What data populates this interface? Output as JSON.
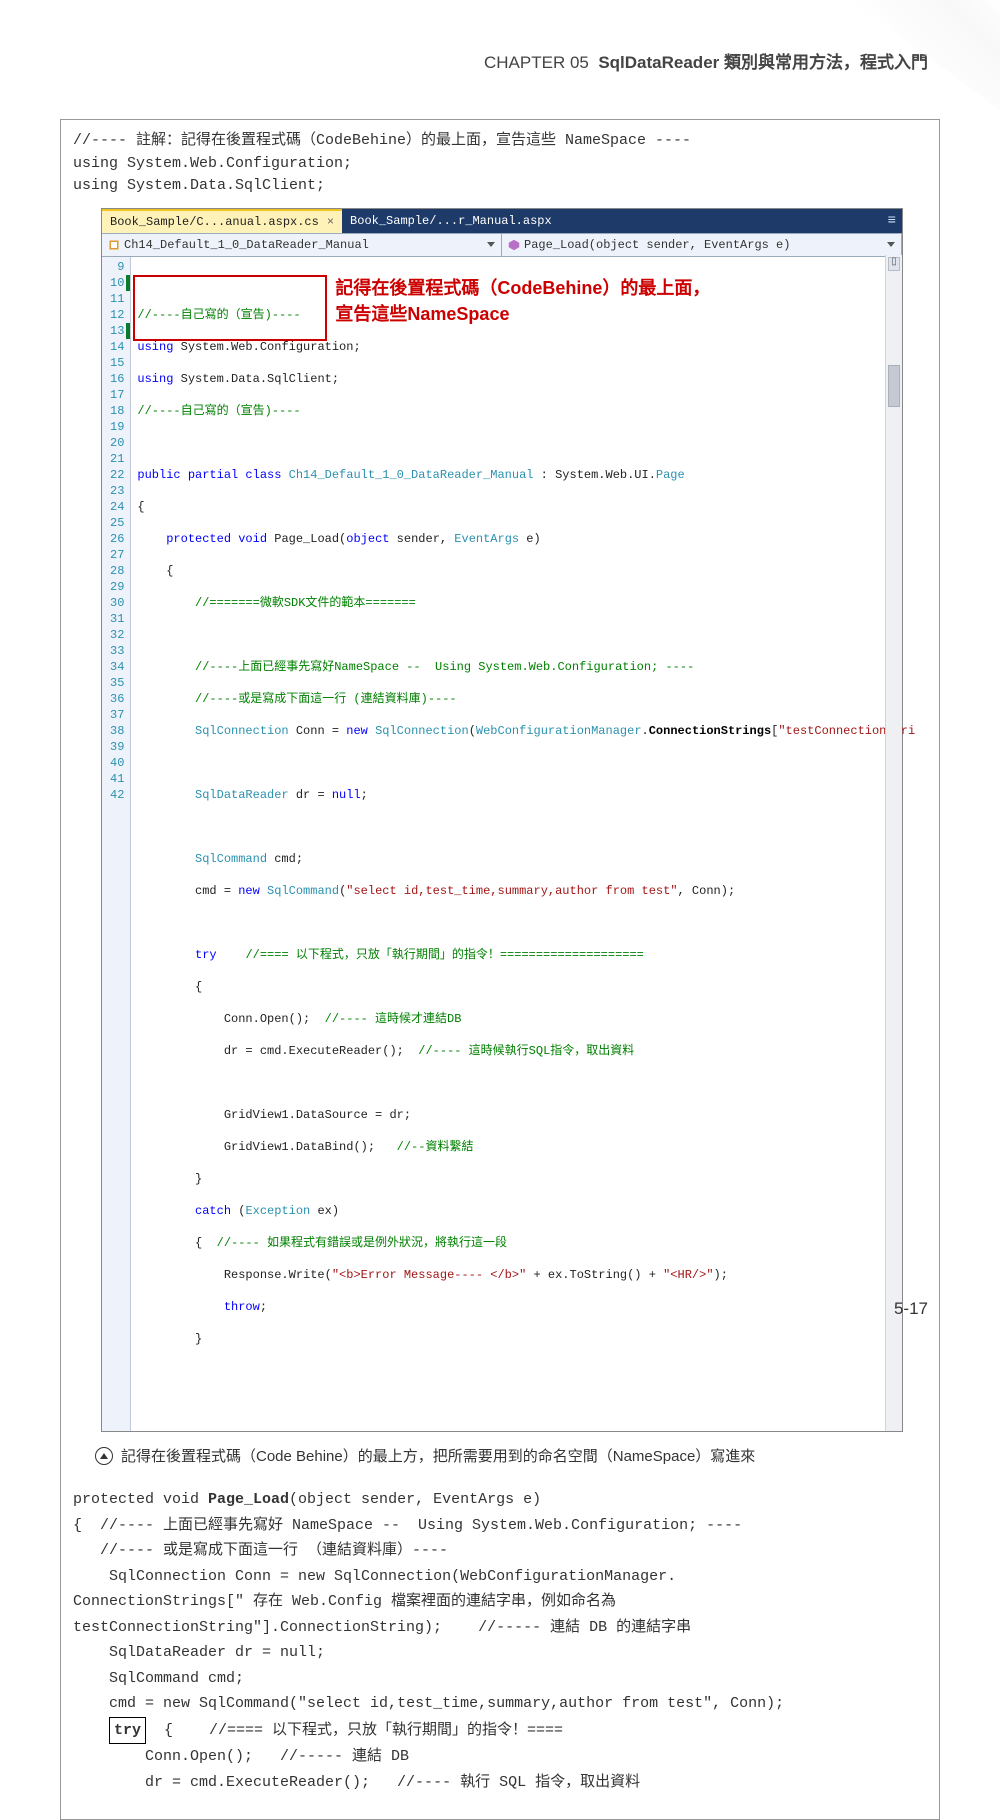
{
  "header": {
    "chapter": "CHAPTER 05",
    "title": "SqlDataReader 類別與常用方法，程式入門"
  },
  "top_code": {
    "l1": "//---- 註解：記得在後置程式碼（CodeBehine）的最上面，宣告這些 NameSpace ----",
    "l2": "using System.Web.Configuration;",
    "l3": "using System.Data.SqlClient;"
  },
  "vs": {
    "tab_active": "Book_Sample/C...anual.aspx.cs",
    "tab_inactive": "Book_Sample/...r_Manual.aspx",
    "dd_left": "Ch14_Default_1_0_DataReader_Manual",
    "dd_right": "Page_Load(object sender, EventArgs e)",
    "annot_l1": "記得在後置程式碼（CodeBehine）的最上面，",
    "annot_l2": "宣告這些NameSpace",
    "lines": {
      "9": "",
      "10": "//----自己寫的（宣告)----",
      "11": "using System.Web.Configuration;",
      "12": "using System.Data.SqlClient;",
      "13": "//----自己寫的（宣告)----",
      "14": "",
      "15": "public partial class Ch14_Default_1_0_DataReader_Manual : System.Web.UI.Page",
      "16": "{",
      "17": "    protected void Page_Load(object sender, EventArgs e)",
      "18": "    {",
      "19": "        //=======微軟SDK文件的範本=======",
      "20": "",
      "21": "        //----上面已經事先寫好NameSpace --  Using System.Web.Configuration; ----",
      "22": "        //----或是寫成下面這一行 (連結資料庫)----",
      "23": "        SqlConnection Conn = new SqlConnection(WebConfigurationManager.ConnectionStrings[\"testConnectionStri",
      "24": "",
      "25": "        SqlDataReader dr = null;",
      "26": "",
      "27": "        SqlCommand cmd;",
      "28": "        cmd = new SqlCommand(\"select id,test_time,summary,author from test\", Conn);",
      "29": "",
      "30": "        try    //==== 以下程式，只放「執行期間」的指令！====================",
      "31": "        {",
      "32": "            Conn.Open();  //---- 這時候才連結DB",
      "33": "            dr = cmd.ExecuteReader();  //---- 這時候執行SQL指令，取出資料",
      "34": "",
      "35": "            GridView1.DataSource = dr;",
      "36": "            GridView1.DataBind();   //--資料繫結",
      "37": "        }",
      "38": "        catch (Exception ex)",
      "39": "        {  //---- 如果程式有錯誤或是例外狀況，將執行這一段",
      "40": "            Response.Write(\"<b>Error Message---- </b>\" + ex.ToString() + \"<HR/>\");",
      "41": "            throw;",
      "42": "        }"
    }
  },
  "caption": "記得在後置程式碼（Code Behine）的最上方，把所需要用到的命名空間（NameSpace）寫進來",
  "lower_code": {
    "l1a": "protected void ",
    "l1b": "Page_Load",
    "l1c": "(object sender, EventArgs e)",
    "l2": "{  //---- 上面已經事先寫好 NameSpace --  Using System.Web.Configuration; ----",
    "l3": "   //---- 或是寫成下面這一行 （連結資料庫）----",
    "l4": "    SqlConnection Conn = new SqlConnection(WebConfigurationManager.",
    "l5": "ConnectionStrings[\" 存在 Web.Config 檔案裡面的連結字串，例如命名為",
    "l6": "testConnectionString\"].ConnectionString);    //----- 連結 DB 的連結字串",
    "l7": "",
    "l8": "    SqlDataReader dr = null;",
    "l9": "    SqlCommand cmd;",
    "l10": "    cmd = new SqlCommand(\"select id,test_time,summary,author from test\", Conn);",
    "l11": "",
    "l12a": "    ",
    "l12b": "try",
    "l12c": "  {    //==== 以下程式，只放「執行期間」的指令！====",
    "l13": "        Conn.Open();   //----- 連結 DB",
    "l14": "        dr = cmd.ExecuteReader();   //---- 執行 SQL 指令，取出資料"
  },
  "pagenum": "5-17"
}
